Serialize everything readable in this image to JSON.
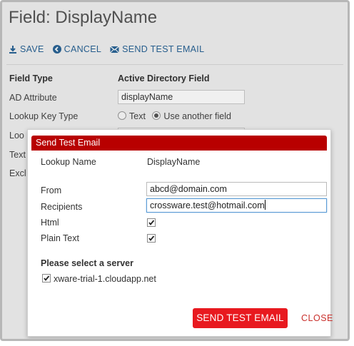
{
  "page": {
    "title": "Field: DisplayName",
    "toolbar": {
      "save_label": "SAVE",
      "cancel_label": "CANCEL",
      "send_test_email_label": "SEND TEST EMAIL"
    },
    "field_type_label": "Field Type",
    "field_type_value": "Active Directory Field",
    "ad_attribute_label": "AD Attribute",
    "ad_attribute_value": "displayName",
    "lookup_key_type_label": "Lookup Key Type",
    "lookup_key_options": [
      "Text",
      "Use another field"
    ],
    "lookup_key_selected": "Use another field",
    "partial_label_1": "Loo",
    "partial_label_2": "Text",
    "partial_label_3": "Excl"
  },
  "modal": {
    "title": "Send Test Email",
    "lookup_name_label": "Lookup Name",
    "lookup_name_value": "DisplayName",
    "from_label": "From",
    "from_value": "abcd@domain.com",
    "recipients_label": "Recipients",
    "recipients_value": "crossware.test@hotmail.com",
    "html_label": "Html",
    "html_checked": true,
    "plain_text_label": "Plain Text",
    "plain_text_checked": true,
    "server_heading": "Please select a server",
    "server_option": "xware-trial-1.cloudapp.net",
    "server_checked": true,
    "send_button_label": "SEND TEST EMAIL",
    "close_button_label": "CLOSE"
  },
  "colors": {
    "modal_header": "#b80000",
    "send_button": "#e8191f",
    "close_link": "#c9302c",
    "toolbar_link": "#2a6496"
  }
}
